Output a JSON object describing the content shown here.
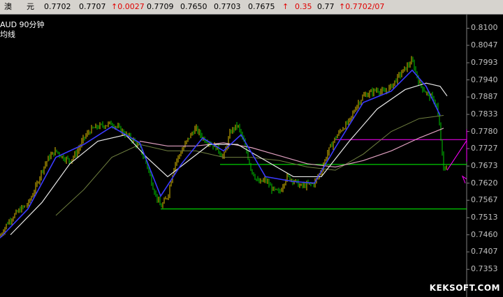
{
  "quote": {
    "name_a": "澳",
    "name_b": "元",
    "v1": "0.7702",
    "v2": "0.7707",
    "change": "↑0.0027",
    "v3": "0.7709",
    "v4": "0.7650",
    "v5": "0.7703",
    "v6": "0.7675",
    "arrow": "↑",
    "v7": "0.35",
    "v8": "0.77",
    "v9": "↑0.7702/07"
  },
  "chart_labels": {
    "symbol_period": "AUD  90分钟",
    "ma_label": "均线",
    "watermark": "KEKSOFT.COM"
  },
  "colors": {
    "background": "#000000",
    "bull_candle": "#e0c000",
    "bear_candle": "#00c800",
    "ma_blue": "#3a3aff",
    "ma_white": "#e8e8e8",
    "ma_pink": "#e0a0c0",
    "ma_olive": "#708040",
    "support_green": "#00ff00",
    "resistance_magenta": "#ff00ff"
  },
  "chart_data": {
    "type": "line",
    "series_kind": "candlestick_with_moving_averages",
    "ylim": [
      0.7332,
      0.8127
    ],
    "yticks": [
      "0.8100",
      "0.8047",
      "0.7993",
      "0.7940",
      "0.7887",
      "0.7833",
      "0.7780",
      "0.7727",
      "0.7673",
      "0.7620",
      "0.7567",
      "0.7513",
      "0.7460",
      "0.7407",
      "0.7353"
    ],
    "price_path": [
      [
        0,
        0.7455
      ],
      [
        10,
        0.7495
      ],
      [
        20,
        0.752
      ],
      [
        30,
        0.754
      ],
      [
        40,
        0.7555
      ],
      [
        50,
        0.76
      ],
      [
        60,
        0.766
      ],
      [
        70,
        0.77
      ],
      [
        80,
        0.772
      ],
      [
        90,
        0.77
      ],
      [
        100,
        0.769
      ],
      [
        110,
        0.7715
      ],
      [
        120,
        0.776
      ],
      [
        130,
        0.7785
      ],
      [
        140,
        0.7795
      ],
      [
        150,
        0.78
      ],
      [
        160,
        0.7805
      ],
      [
        170,
        0.779
      ],
      [
        180,
        0.777
      ],
      [
        190,
        0.7755
      ],
      [
        200,
        0.773
      ],
      [
        210,
        0.768
      ],
      [
        220,
        0.76
      ],
      [
        230,
        0.7545
      ],
      [
        240,
        0.758
      ],
      [
        250,
        0.768
      ],
      [
        260,
        0.772
      ],
      [
        270,
        0.776
      ],
      [
        280,
        0.779
      ],
      [
        290,
        0.776
      ],
      [
        300,
        0.7745
      ],
      [
        310,
        0.773
      ],
      [
        320,
        0.77
      ],
      [
        330,
        0.778
      ],
      [
        340,
        0.78
      ],
      [
        350,
        0.774
      ],
      [
        360,
        0.766
      ],
      [
        370,
        0.762
      ],
      [
        380,
        0.763
      ],
      [
        390,
        0.76
      ],
      [
        400,
        0.759
      ],
      [
        410,
        0.764
      ],
      [
        420,
        0.763
      ],
      [
        430,
        0.761
      ],
      [
        440,
        0.7615
      ],
      [
        450,
        0.762
      ],
      [
        460,
        0.766
      ],
      [
        470,
        0.772
      ],
      [
        480,
        0.776
      ],
      [
        490,
        0.779
      ],
      [
        500,
        0.781
      ],
      [
        510,
        0.786
      ],
      [
        520,
        0.789
      ],
      [
        530,
        0.79
      ],
      [
        540,
        0.791
      ],
      [
        550,
        0.79
      ],
      [
        560,
        0.792
      ],
      [
        570,
        0.795
      ],
      [
        580,
        0.7975
      ],
      [
        590,
        0.8
      ],
      [
        600,
        0.793
      ],
      [
        610,
        0.79
      ],
      [
        620,
        0.788
      ],
      [
        625,
        0.786
      ],
      [
        630,
        0.778
      ],
      [
        635,
        0.766
      ],
      [
        640,
        0.7675
      ]
    ],
    "ma_fast_blue": [
      [
        0,
        0.745
      ],
      [
        40,
        0.754
      ],
      [
        80,
        0.77
      ],
      [
        120,
        0.774
      ],
      [
        160,
        0.7795
      ],
      [
        200,
        0.7745
      ],
      [
        230,
        0.758
      ],
      [
        260,
        0.768
      ],
      [
        290,
        0.776
      ],
      [
        320,
        0.772
      ],
      [
        345,
        0.777
      ],
      [
        380,
        0.764
      ],
      [
        420,
        0.7625
      ],
      [
        450,
        0.762
      ],
      [
        480,
        0.773
      ],
      [
        520,
        0.787
      ],
      [
        560,
        0.7905
      ],
      [
        590,
        0.797
      ],
      [
        610,
        0.792
      ],
      [
        630,
        0.783
      ]
    ],
    "ma_white": [
      [
        15,
        0.746
      ],
      [
        60,
        0.756
      ],
      [
        100,
        0.768
      ],
      [
        140,
        0.775
      ],
      [
        180,
        0.777
      ],
      [
        210,
        0.77
      ],
      [
        240,
        0.764
      ],
      [
        270,
        0.769
      ],
      [
        300,
        0.774
      ],
      [
        340,
        0.774
      ],
      [
        380,
        0.769
      ],
      [
        420,
        0.764
      ],
      [
        460,
        0.764
      ],
      [
        500,
        0.775
      ],
      [
        540,
        0.785
      ],
      [
        580,
        0.791
      ],
      [
        610,
        0.793
      ],
      [
        630,
        0.792
      ],
      [
        640,
        0.789
      ]
    ],
    "ma_pink": [
      [
        200,
        0.775
      ],
      [
        240,
        0.7735
      ],
      [
        280,
        0.7735
      ],
      [
        320,
        0.7745
      ],
      [
        360,
        0.773
      ],
      [
        400,
        0.7705
      ],
      [
        440,
        0.768
      ],
      [
        480,
        0.767
      ],
      [
        520,
        0.769
      ],
      [
        560,
        0.772
      ],
      [
        600,
        0.776
      ],
      [
        635,
        0.779
      ]
    ],
    "ma_olive": [
      [
        80,
        0.752
      ],
      [
        120,
        0.76
      ],
      [
        160,
        0.77
      ],
      [
        200,
        0.774
      ],
      [
        240,
        0.772
      ],
      [
        280,
        0.772
      ],
      [
        320,
        0.77
      ],
      [
        360,
        0.77
      ],
      [
        400,
        0.769
      ],
      [
        440,
        0.767
      ],
      [
        480,
        0.766
      ],
      [
        520,
        0.771
      ],
      [
        560,
        0.778
      ],
      [
        600,
        0.782
      ],
      [
        635,
        0.783
      ]
    ],
    "horizontal_lines": [
      {
        "y": 0.7755,
        "x_from": 480,
        "x_to": 668,
        "color": "magenta"
      },
      {
        "y": 0.7678,
        "x_from": 315,
        "x_to": 668,
        "color": "green"
      },
      {
        "y": 0.754,
        "x_from": 230,
        "x_to": 668,
        "color": "green"
      }
    ],
    "projection": {
      "points": [
        [
          640,
          0.766
        ],
        [
          668,
          0.7752
        ]
      ],
      "end_arrow_y": 0.765
    }
  }
}
